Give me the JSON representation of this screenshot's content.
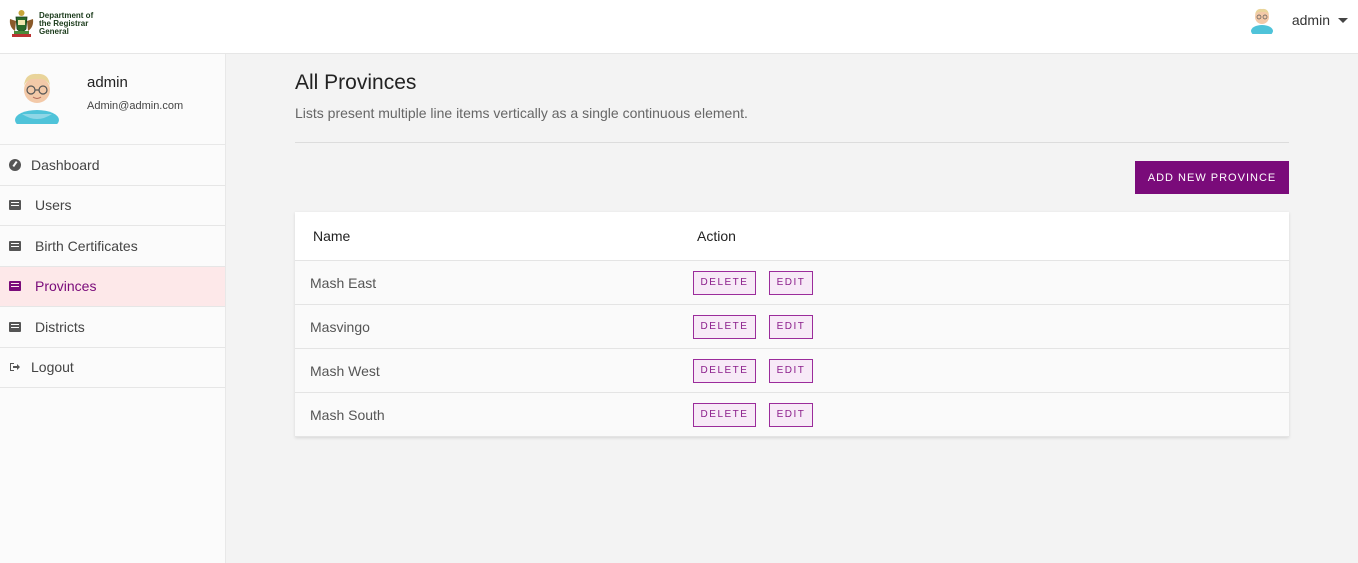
{
  "brand": {
    "line1": "Department of",
    "line2": "the Registrar",
    "line3": "General"
  },
  "header": {
    "username": "admin"
  },
  "sidebar": {
    "profile": {
      "name": "admin",
      "email": "Admin@admin.com"
    },
    "items": [
      {
        "label": "Dashboard",
        "icon": "dashboard-icon"
      },
      {
        "label": "Users",
        "icon": "list-icon"
      },
      {
        "label": "Birth Certificates",
        "icon": "list-icon"
      },
      {
        "label": "Provinces",
        "icon": "list-icon",
        "active": true
      },
      {
        "label": "Districts",
        "icon": "list-icon"
      },
      {
        "label": "Logout",
        "icon": "logout-icon"
      }
    ]
  },
  "main": {
    "title": "All Provinces",
    "subtitle": "Lists present multiple line items vertically as a single continuous element.",
    "add_button": "ADD NEW PROVINCE",
    "table": {
      "headers": [
        "Name",
        "Action"
      ],
      "rows": [
        {
          "name": "Mash East"
        },
        {
          "name": "Masvingo"
        },
        {
          "name": "Mash West"
        },
        {
          "name": "Mash South"
        }
      ],
      "delete_label": "DELETE",
      "edit_label": "EDIT"
    }
  },
  "colors": {
    "accent": "#7a0b7a",
    "active_bg": "#fde8e9"
  }
}
